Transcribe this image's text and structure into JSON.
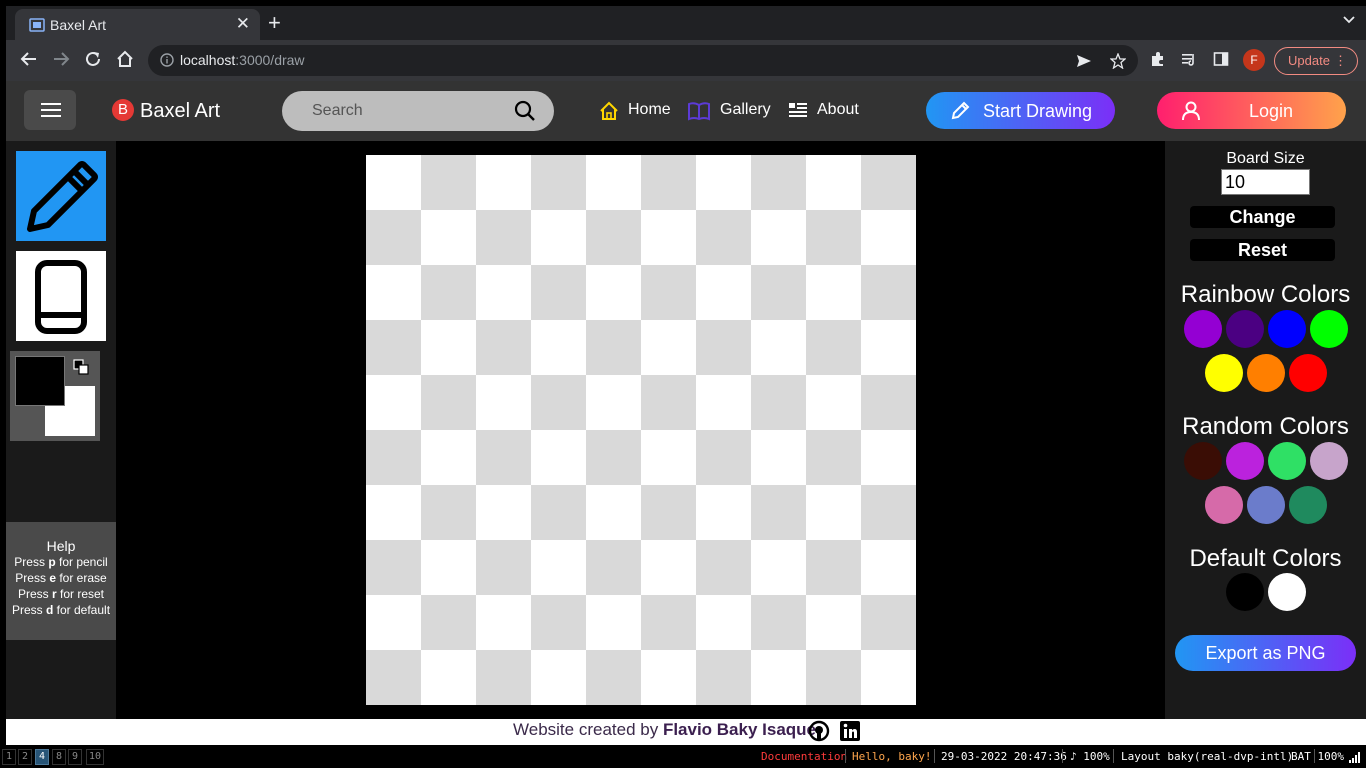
{
  "browser": {
    "tab_title": "Baxel Art",
    "url_host": "localhost",
    "url_path": ":3000/draw",
    "profile_initial": "F",
    "update_label": "Update"
  },
  "app": {
    "logo_letter": "B",
    "brand": "Baxel Art",
    "search_placeholder": "Search",
    "nav": {
      "home": "Home",
      "gallery": "Gallery",
      "about": "About"
    },
    "start_drawing": "Start Drawing",
    "login": "Login"
  },
  "tools": {
    "primary_color": "#000000",
    "secondary_color": "#ffffff",
    "help": {
      "title": "Help",
      "lines": [
        {
          "pre": "Press ",
          "key": "p",
          "post": " for pencil"
        },
        {
          "pre": "Press ",
          "key": "e",
          "post": " for erase"
        },
        {
          "pre": "Press ",
          "key": "r",
          "post": " for reset"
        },
        {
          "pre": "Press ",
          "key": "d",
          "post": " for default"
        }
      ]
    }
  },
  "board": {
    "size": "10",
    "light_cell": "#ffffff",
    "dark_cell": "#d9d9d9"
  },
  "panel": {
    "board_size_label": "Board Size",
    "change_label": "Change",
    "reset_label": "Reset",
    "rainbow_title": "Rainbow Colors",
    "rainbow_colors": [
      "#9400d3",
      "#4b0082",
      "#0000ff",
      "#00ff00",
      "#ffff00",
      "#ff7f00",
      "#ff0000"
    ],
    "random_title": "Random Colors",
    "random_colors": [
      "#3a0d05",
      "#bb22dd",
      "#2fe065",
      "#c7a4cb",
      "#d66aa9",
      "#6b7ccb",
      "#1f8a5e"
    ],
    "default_title": "Default Colors",
    "default_colors": [
      "#000000",
      "#ffffff"
    ],
    "export_label": "Export as PNG"
  },
  "footer": {
    "prefix": "Website created by ",
    "author": "Flavio Baky Isaque"
  },
  "statusbar": {
    "workspaces": [
      "1",
      "2",
      "4",
      "8",
      "9",
      "10"
    ],
    "active_workspace": "4",
    "documentation": "Documentation",
    "greeting": "Hello, baky!",
    "datetime": "29-03-2022 20:47:36",
    "volume": "♪ 100%",
    "layout": "Layout baky(real-dvp-intl)",
    "battery": "BAT 100%"
  }
}
